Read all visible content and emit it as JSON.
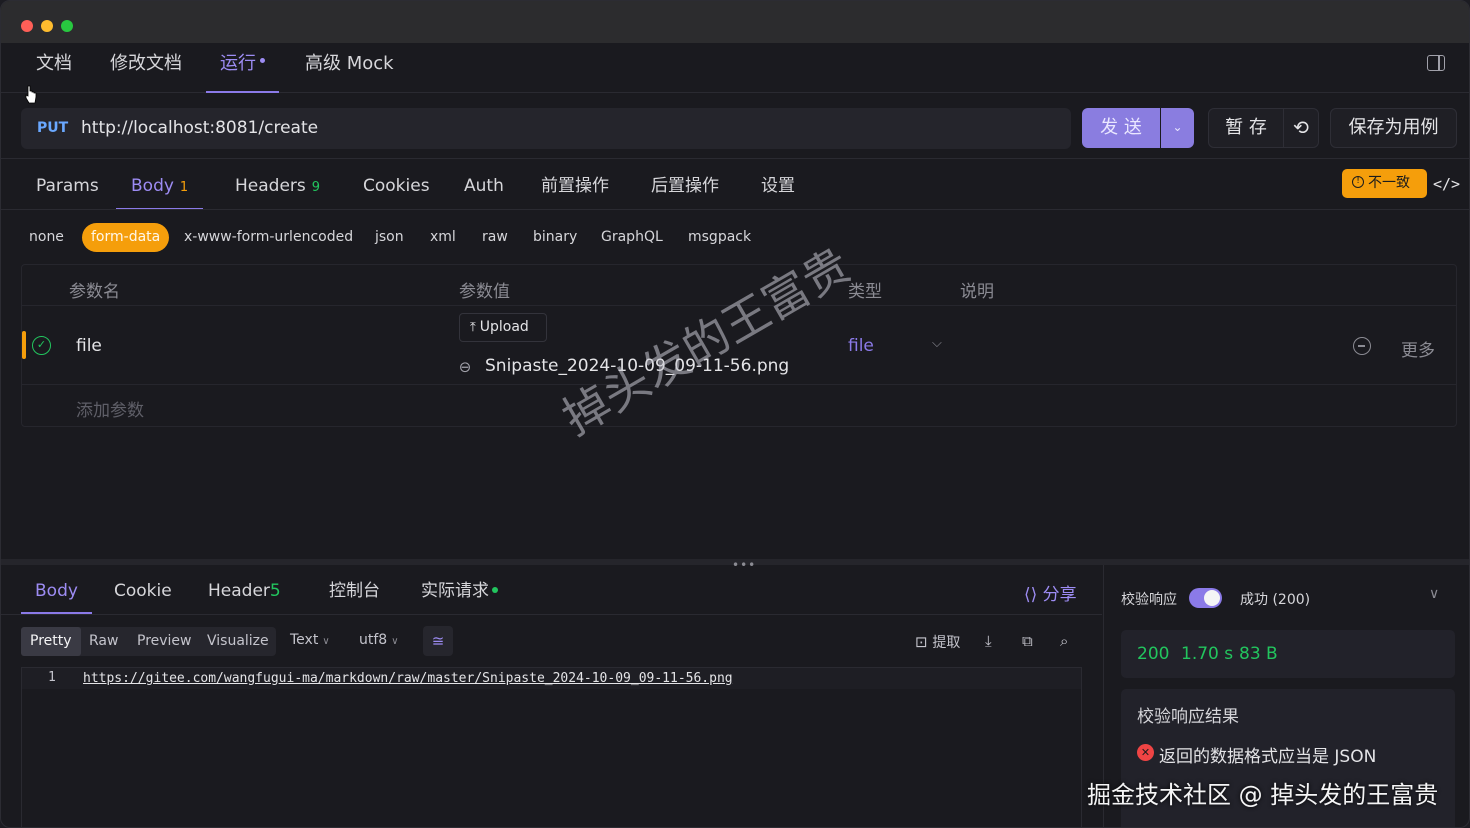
{
  "topnav": {
    "tabs": [
      {
        "label": "文档"
      },
      {
        "label": "修改文档"
      },
      {
        "label": "运行"
      },
      {
        "label": "高级 Mock"
      }
    ]
  },
  "request": {
    "method": "PUT",
    "url": "http://localhost:8081/create",
    "send_label": "发 送",
    "save_draft_label": "暂 存",
    "save_case_label": "保存为用例"
  },
  "req_tabs": [
    {
      "label": "Params",
      "count": ""
    },
    {
      "label": "Body",
      "count": "1"
    },
    {
      "label": "Headers",
      "count": "9"
    },
    {
      "label": "Cookies",
      "count": ""
    },
    {
      "label": "Auth",
      "count": ""
    },
    {
      "label": "前置操作",
      "count": ""
    },
    {
      "label": "后置操作",
      "count": ""
    },
    {
      "label": "设置",
      "count": ""
    }
  ],
  "mismatch_badge": "不一致",
  "body_types": [
    "none",
    "form-data",
    "x-www-form-urlencoded",
    "json",
    "xml",
    "raw",
    "binary",
    "GraphQL",
    "msgpack"
  ],
  "params_table": {
    "headers": {
      "name": "参数名",
      "value": "参数值",
      "type": "类型",
      "desc": "说明"
    },
    "rows": [
      {
        "name": "file",
        "upload_label": "Upload",
        "file_name": "Snipaste_2024-10-09_09-11-56.png",
        "type": "file",
        "more": "更多"
      }
    ],
    "add_placeholder": "添加参数"
  },
  "watermark": "掉头发的王富贵",
  "response": {
    "tabs": [
      {
        "label": "Body",
        "count": ""
      },
      {
        "label": "Cookie",
        "count": ""
      },
      {
        "label": "Header",
        "count": "5"
      },
      {
        "label": "控制台",
        "count": ""
      },
      {
        "label": "实际请求",
        "count": ""
      }
    ],
    "share_label": "分享",
    "formats": [
      "Pretty",
      "Raw",
      "Preview",
      "Visualize"
    ],
    "text_select": "Text",
    "encoding_select": "utf8",
    "extract_label": "提取",
    "line_number": "1",
    "body_text": "https://gitee.com/wangfugui-ma/markdown/raw/master/Snipaste_2024-10-09_09-11-56.png"
  },
  "validation": {
    "label": "校验响应",
    "status_option": "成功 (200)",
    "status_code": "200",
    "time": "1.70 s",
    "size": "83 B",
    "result_title": "校验响应结果",
    "error_text": "返回的数据格式应当是 JSON"
  },
  "footer_watermark": "掘金技术社区 @ 掉头发的王富贵",
  "colors": {
    "accent": "#8b7ae8",
    "orange": "#f59e0b",
    "success": "#22c55e",
    "error": "#ef4444"
  }
}
